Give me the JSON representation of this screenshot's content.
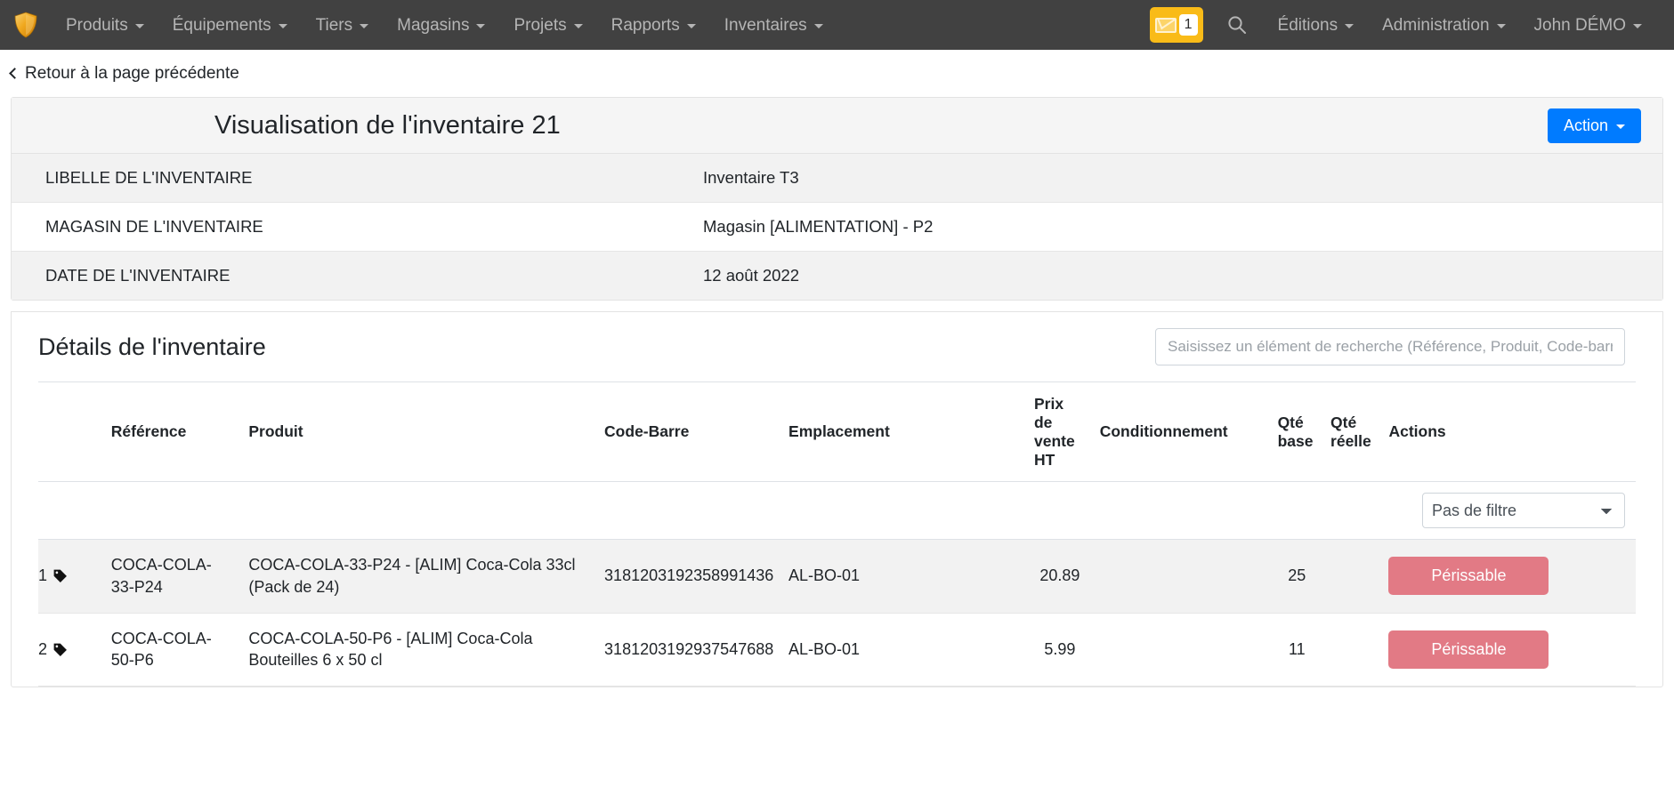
{
  "navbar": {
    "logo": "shield-logo",
    "left_items": [
      {
        "label": "Produits",
        "has_caret": true
      },
      {
        "label": "Équipements",
        "has_caret": true
      },
      {
        "label": "Tiers",
        "has_caret": true
      },
      {
        "label": "Magasins",
        "has_caret": true
      },
      {
        "label": "Projets",
        "has_caret": true
      },
      {
        "label": "Rapports",
        "has_caret": true
      },
      {
        "label": "Inventaires",
        "has_caret": true
      }
    ],
    "mail_badge_count": "1",
    "right_items": [
      {
        "label": "Éditions",
        "has_caret": true
      },
      {
        "label": "Administration",
        "has_caret": true
      },
      {
        "label": "John DÉMO",
        "has_caret": true
      }
    ],
    "background_color": "#414141",
    "mail_button_color": "#f9bb18"
  },
  "back_link": {
    "label": "Retour à la page précédente"
  },
  "header": {
    "title": "Visualisation de l'inventaire 21",
    "action_label": "Action",
    "action_color": "#007bff"
  },
  "info_table": {
    "rows": [
      {
        "label": "LIBELLE DE L'INVENTAIRE",
        "value": "Inventaire T3"
      },
      {
        "label": "MAGASIN DE L'INVENTAIRE",
        "value": "Magasin [ALIMENTATION] - P2"
      },
      {
        "label": "DATE DE L'INVENTAIRE",
        "value": "12 août 2022"
      }
    ]
  },
  "details": {
    "title": "Détails de l'inventaire",
    "search_placeholder": "Saisissez un élément de recherche (Référence, Produit, Code-barre ou Emplacement)",
    "search_value": "",
    "filter_selected": "Pas de filtre",
    "filter_options": [
      "Pas de filtre"
    ],
    "columns": {
      "reference": "Référence",
      "produit": "Produit",
      "code_barre": "Code-Barre",
      "emplacement": "Emplacement",
      "prix_vente_ht": "Prix de vente HT",
      "conditionnement": "Conditionnement",
      "qte_base": "Qté base",
      "qte_reelle": "Qté réelle",
      "actions": "Actions"
    },
    "rows": [
      {
        "index": "1",
        "icon": "tag-icon",
        "reference": "COCA-COLA-33-P24",
        "produit": "COCA-COLA-33-P24 - [ALIM] Coca-Cola 33cl (Pack de 24)",
        "code_barre": "3181203192358991436",
        "emplacement": "AL-BO-01",
        "prix_vente_ht": "20.89",
        "conditionnement": "",
        "qte_base": "25",
        "qte_reelle": "",
        "action_label": "Périssable",
        "action_color": "#e27a85"
      },
      {
        "index": "2",
        "icon": "tag-icon",
        "reference": "COCA-COLA-50-P6",
        "produit": "COCA-COLA-50-P6 - [ALIM] Coca-Cola Bouteilles 6 x 50 cl",
        "code_barre": "3181203192937547688",
        "emplacement": "AL-BO-01",
        "prix_vente_ht": "5.99",
        "conditionnement": "",
        "qte_base": "11",
        "qte_reelle": "",
        "action_label": "Périssable",
        "action_color": "#e27a85"
      }
    ]
  }
}
